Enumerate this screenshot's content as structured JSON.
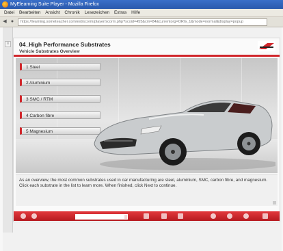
{
  "browser": {
    "title": "MyElearning Suite Player - Mozilla Firefox",
    "menu": [
      "Datei",
      "Bearbeiten",
      "Ansicht",
      "Chronik",
      "Lesezeichen",
      "Extras",
      "Hilfe"
    ],
    "url": "https://learning.someteacher.com/ext/scorm/player/scorm.php?scoid=455&cm=84&currentorg=ORG_1&mode=normal&display=popup"
  },
  "course": {
    "title": "04_High Performance Substrates",
    "subtitle": "Vehicle Substrates Overview",
    "items": [
      {
        "label": "1  Steel"
      },
      {
        "label": "2  Aluminium"
      },
      {
        "label": "3  SMC / RTM"
      },
      {
        "label": "4  Carbon fibre"
      },
      {
        "label": "5  Magnesium"
      }
    ],
    "description": "As an overview, the most common substrates used in car manufacturing are steel, aluminium, SMC, carbon fibre, and magnesium. Click each substrate in the list to learn more. When finished, click Next to continue."
  },
  "player": {
    "progress": 0.95
  },
  "colors": {
    "accent": "#d1262b",
    "titlebar": "#2a59ad"
  },
  "icons": {
    "back": "arrow-left-icon",
    "forward": "arrow-right-icon",
    "reload": "reload-icon",
    "lock": "lock-icon"
  }
}
